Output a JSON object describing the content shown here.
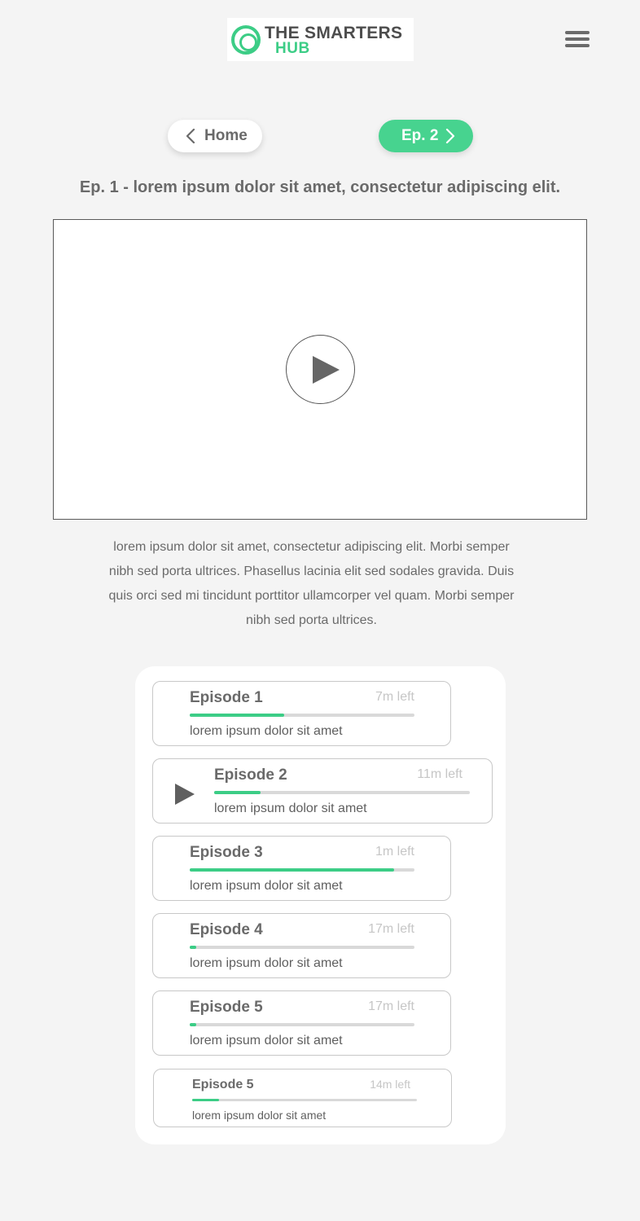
{
  "brand": {
    "line1": "THE SMARTERS",
    "line2": "HUB",
    "accent": "#3ccd86"
  },
  "nav": {
    "home_label": "Home",
    "next_label": "Ep. 2"
  },
  "page_title": "Ep. 1 - lorem ipsum dolor sit amet, consectetur adipiscing elit.",
  "description": "lorem ipsum dolor sit amet, consectetur adipiscing elit. Morbi semper nibh sed porta ultrices. Phasellus lacinia elit sed sodales gravida. Duis quis orci sed mi tincidunt porttitor ullamcorper vel quam. Morbi semper nibh sed porta ultrices.",
  "episodes": [
    {
      "title": "Episode 1",
      "time_left": "7m left",
      "progress": 0.42,
      "desc": "lorem ipsum dolor sit amet"
    },
    {
      "title": "Episode 2",
      "time_left": "11m left",
      "progress": 0.18,
      "desc": "lorem ipsum dolor sit amet"
    },
    {
      "title": "Episode 3",
      "time_left": "1m left",
      "progress": 0.91,
      "desc": "lorem ipsum dolor sit amet"
    },
    {
      "title": "Episode 4",
      "time_left": "17m left",
      "progress": 0.03,
      "desc": "lorem ipsum dolor sit amet"
    },
    {
      "title": "Episode 5",
      "time_left": "17m left",
      "progress": 0.03,
      "desc": "lorem ipsum dolor sit amet"
    },
    {
      "title": "Episode 5",
      "time_left": "14m left",
      "progress": 0.12,
      "desc": "lorem ipsum dolor sit amet"
    }
  ]
}
